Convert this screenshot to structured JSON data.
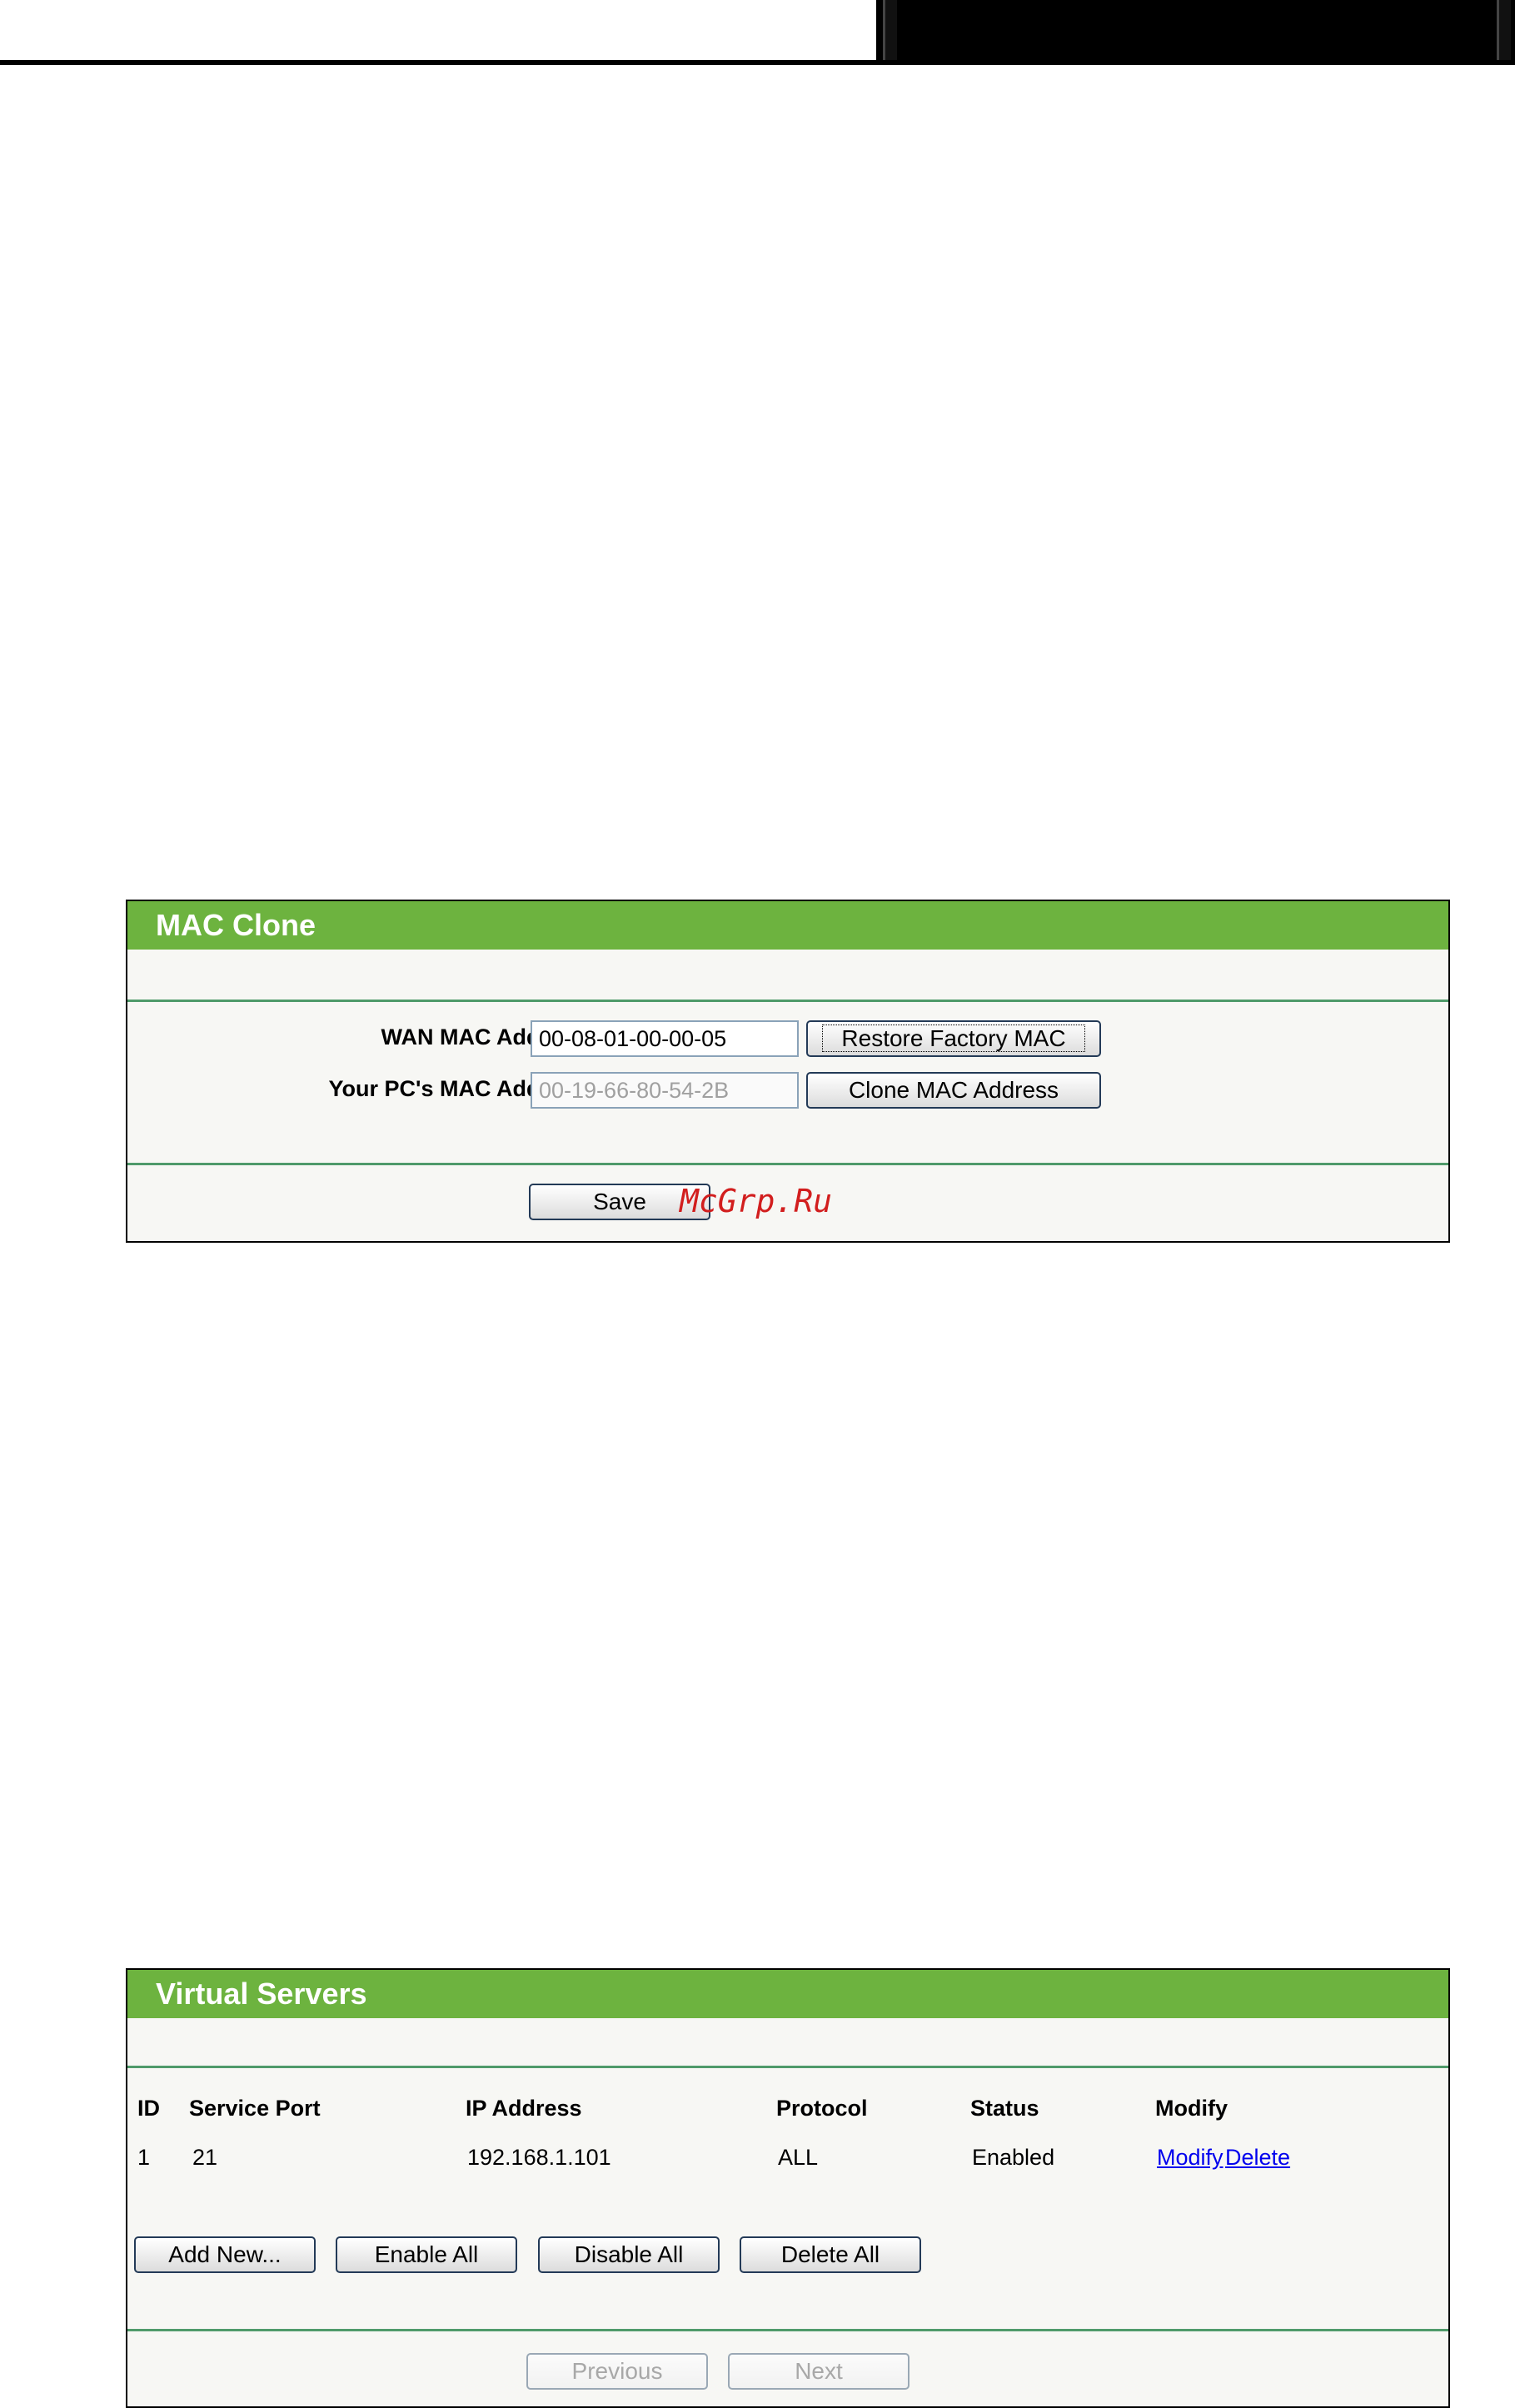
{
  "mac_clone": {
    "title": "MAC Clone",
    "wan_mac_label": "WAN MAC Address:",
    "wan_mac_value": "00-08-01-00-00-05",
    "pc_mac_label": "Your PC's MAC Address:",
    "pc_mac_value": "00-19-66-80-54-2B",
    "restore_button": "Restore Factory MAC",
    "clone_button": "Clone MAC Address",
    "save_button": "Save",
    "watermark": "McGrp.Ru"
  },
  "virtual_servers": {
    "title": "Virtual Servers",
    "columns": [
      "ID",
      "Service Port",
      "IP Address",
      "Protocol",
      "Status",
      "Modify"
    ],
    "rows": [
      {
        "id": "1",
        "service_port": "21",
        "ip_address": "192.168.1.101",
        "protocol": "ALL",
        "status": "Enabled",
        "modify_link": "Modify",
        "delete_link": "Delete"
      }
    ],
    "buttons": {
      "add_new": "Add New...",
      "enable_all": "Enable All",
      "disable_all": "Disable All",
      "delete_all": "Delete All",
      "previous": "Previous",
      "next": "Next"
    }
  },
  "colors": {
    "title_bar": "#6db33f",
    "divider": "#4f9a6a",
    "panel_bg": "#f7f7f4",
    "link": "#0000ee",
    "watermark": "#d21e1e"
  }
}
